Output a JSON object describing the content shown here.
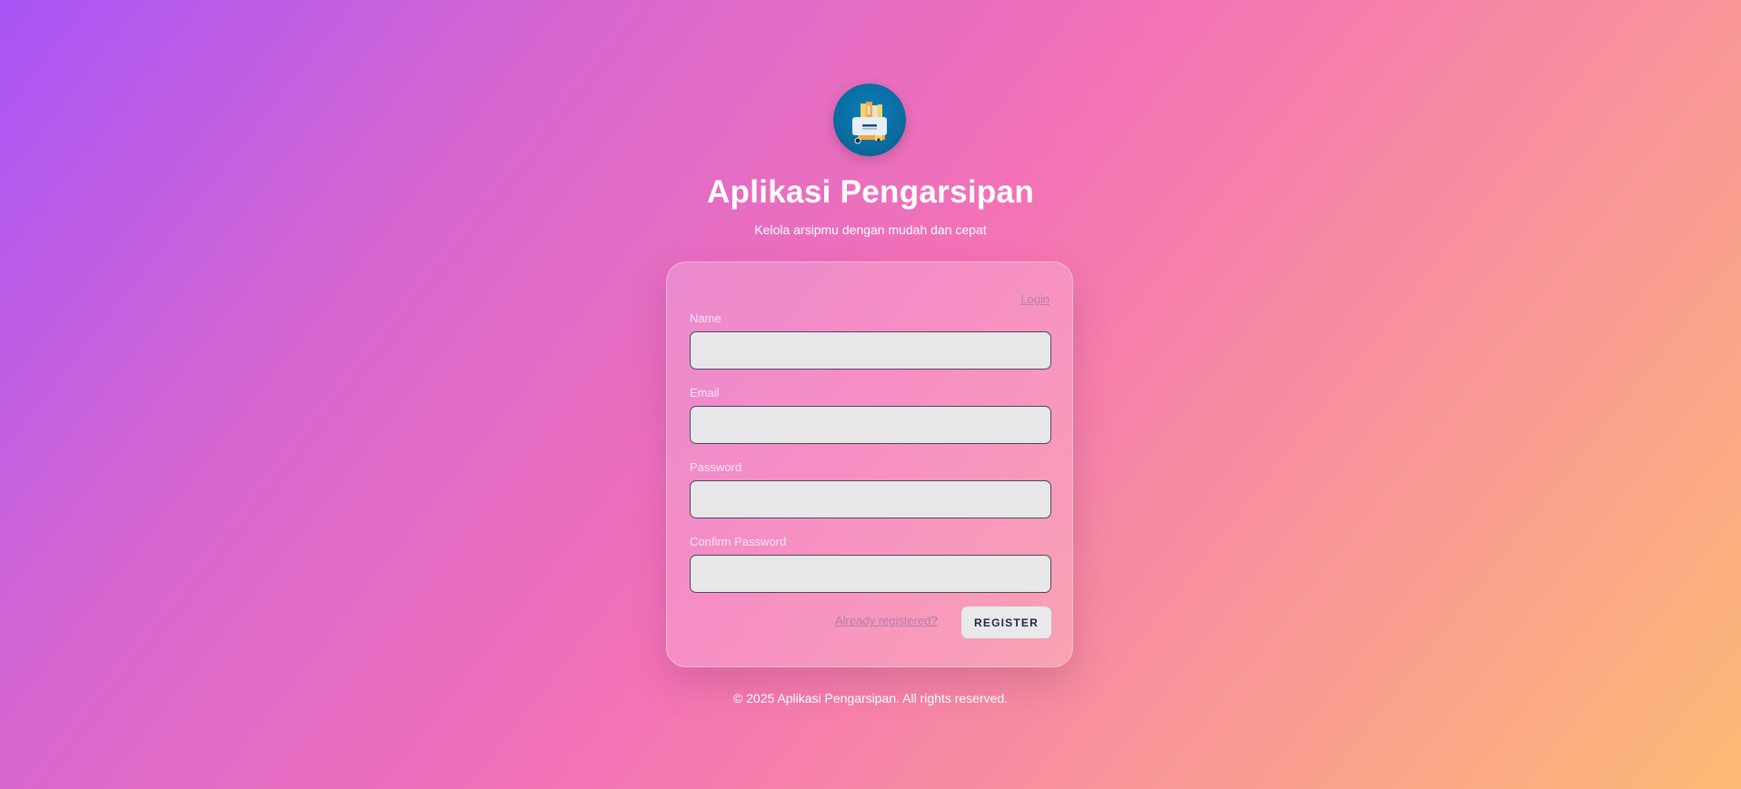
{
  "header": {
    "app_title": "Aplikasi Pengarsipan",
    "subtitle": "Kelola arsipmu dengan mudah dan cepat",
    "logo_icon": "archive-printer-icon"
  },
  "form": {
    "login_link": "Login",
    "fields": [
      {
        "label": "Name",
        "value": "",
        "type": "text"
      },
      {
        "label": "Email",
        "value": "",
        "type": "email"
      },
      {
        "label": "Password",
        "value": "",
        "type": "password"
      },
      {
        "label": "Confirm Password",
        "value": "",
        "type": "password"
      }
    ],
    "already_registered_link": "Already registered?",
    "register_button": "REGISTER"
  },
  "footer": {
    "copyright": "© 2025 Aplikasi Pengarsipan. All rights reserved."
  },
  "colors": {
    "gradient_start": "#a855f7",
    "gradient_mid": "#f472b6",
    "gradient_end": "#fdba74",
    "logo_bg": "#0a6c9f",
    "input_bg": "#e7e7ea"
  }
}
